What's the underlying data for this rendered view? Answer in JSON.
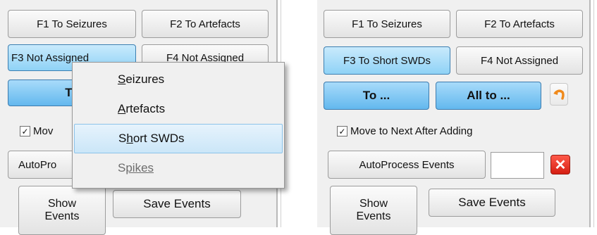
{
  "left_panel": {
    "f1": "F1 To Seizures",
    "f2": "F2 To Artefacts",
    "f3": "F3 Not Assigned",
    "f4": "F4 Not Assigned",
    "to_button": "To",
    "move_checkbox": "Mov",
    "autoprocess": "AutoPro",
    "show_events_line1": "Show",
    "show_events_line2": "Events",
    "save_events": "Save Events"
  },
  "context_menu": {
    "items": [
      {
        "mnemonic": "S",
        "rest": "eizures",
        "pre": ""
      },
      {
        "mnemonic": "A",
        "rest": "rtefacts",
        "pre": ""
      },
      {
        "mnemonic": "h",
        "rest": "ort SWDs",
        "pre": "S"
      },
      {
        "mnemonic": "S",
        "rest": "pikes",
        "pre": ""
      }
    ],
    "highlighted_index": 2,
    "disabled_index": 3
  },
  "right_panel": {
    "f1": "F1 To Seizures",
    "f2": "F2 To Artefacts",
    "f3": "F3 To Short SWDs",
    "f4": "F4 Not Assigned",
    "to_button": "To ...",
    "all_to_button": "All to ...",
    "move_checkbox": "Move to Next After Adding",
    "autoprocess": "AutoProcess Events",
    "event_field_value": "",
    "show_events_line1": "Show",
    "show_events_line2": "Events",
    "save_events": "Save Events"
  },
  "icons": {
    "undo": "undo-arrow-icon",
    "close": "close-icon",
    "check": "checkmark-icon"
  },
  "colors": {
    "selected_button": "#8fd2f6",
    "primary_button": "#63b8ee",
    "close_red": "#d51e12",
    "undo_orange": "#f08a1c",
    "menu_highlight": "#cbe6f8"
  }
}
